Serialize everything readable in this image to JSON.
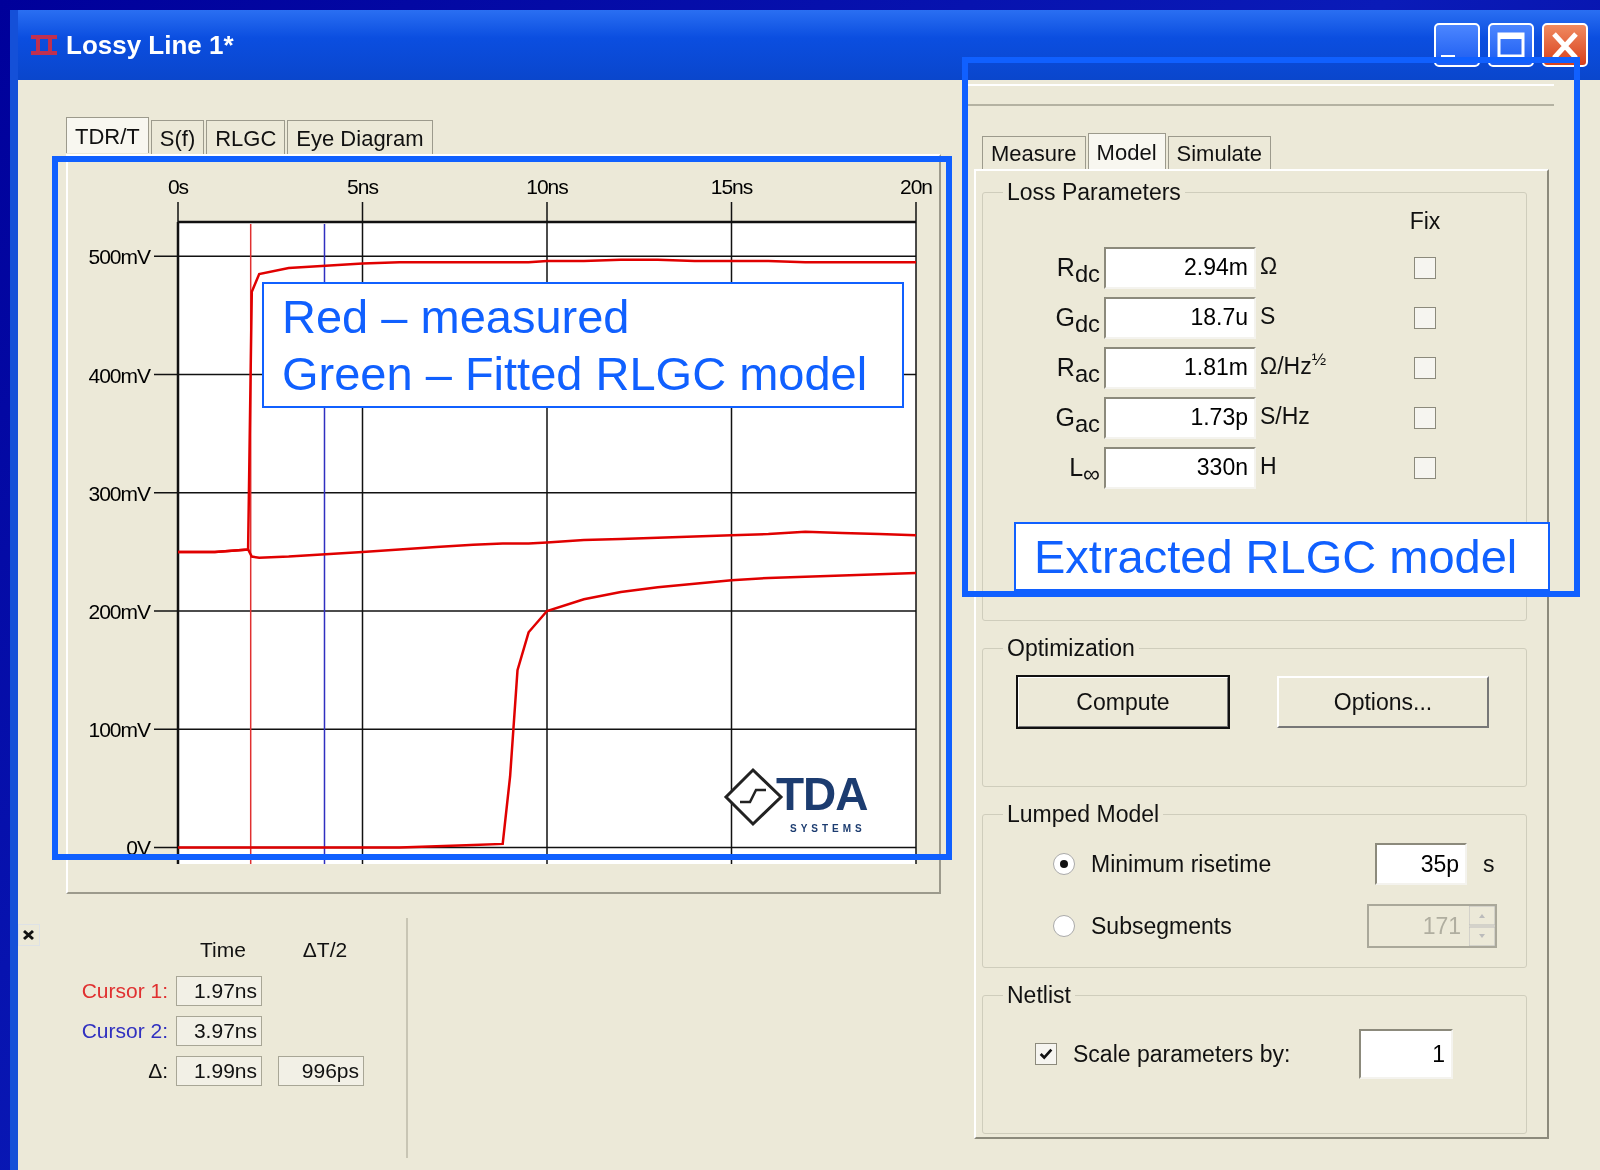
{
  "window": {
    "title": "Lossy Line 1*"
  },
  "left_tabs": [
    {
      "label": "TDR/T",
      "selected": true
    },
    {
      "label": "S(f)",
      "selected": false
    },
    {
      "label": "RLGC",
      "selected": false
    },
    {
      "label": "Eye Diagram",
      "selected": false
    }
  ],
  "chart": {
    "chart_data": {
      "type": "line",
      "x": [
        0,
        1,
        1.9,
        2,
        2.2,
        3,
        4,
        5,
        6,
        7,
        8,
        8.8,
        9,
        9.2,
        9.5,
        10,
        11,
        12,
        13,
        14,
        15,
        16,
        17,
        18,
        19,
        20
      ],
      "series": [
        {
          "color": "#e00000",
          "values": [
            250,
            250,
            252,
            470,
            485,
            490,
            492,
            494,
            495,
            495,
            495,
            495,
            495,
            495,
            495,
            496,
            496,
            497,
            497,
            496,
            496,
            496,
            495,
            495,
            495,
            495
          ]
        },
        {
          "color": "#e00000",
          "values": [
            250,
            250,
            252,
            246,
            245,
            246,
            248,
            250,
            252,
            254,
            256,
            257,
            257,
            257,
            257,
            258,
            260,
            261,
            262,
            263,
            264,
            265,
            267,
            266,
            265,
            264
          ]
        },
        {
          "color": "#e00000",
          "values": [
            0,
            0,
            0,
            0,
            0,
            0,
            0,
            0,
            0,
            1,
            2,
            3,
            60,
            150,
            182,
            200,
            210,
            216,
            220,
            223,
            226,
            228,
            229,
            230,
            231,
            232
          ]
        }
      ],
      "xlim": [
        0,
        20
      ],
      "ylim": [
        -14,
        529
      ],
      "xticks": [
        {
          "value": 0,
          "label": "0s"
        },
        {
          "value": 5,
          "label": "5ns"
        },
        {
          "value": 10,
          "label": "10ns"
        },
        {
          "value": 15,
          "label": "15ns"
        },
        {
          "value": 20,
          "label": "20n"
        }
      ],
      "yticks": [
        {
          "value": 0,
          "label": "0V"
        },
        {
          "value": 100,
          "label": "100mV"
        },
        {
          "value": 200,
          "label": "200mV"
        },
        {
          "value": 300,
          "label": "300mV"
        },
        {
          "value": 400,
          "label": "400mV"
        },
        {
          "value": 500,
          "label": "500mV"
        }
      ],
      "grid": true,
      "ref_lines": [
        {
          "axis": "x",
          "value": 1.97
        },
        {
          "axis": "x",
          "value": 3.97
        }
      ]
    },
    "logo": {
      "text": "TDA",
      "subtext": "SYSTEMS"
    }
  },
  "cursor_panel": {
    "columns": [
      "Time",
      "ΔT/2"
    ],
    "rows": [
      {
        "label": "Cursor 1:",
        "color": "#e03030",
        "values": [
          "1.97ns"
        ]
      },
      {
        "label": "Cursor 2:",
        "color": "#3030c0",
        "values": [
          "3.97ns"
        ]
      },
      {
        "label": "Δ:",
        "values": [
          "1.99ns",
          "996ps"
        ]
      }
    ]
  },
  "right_tabs": [
    {
      "label": "Measure",
      "selected": false
    },
    {
      "label": "Model",
      "selected": true
    },
    {
      "label": "Simulate",
      "selected": false
    }
  ],
  "loss_parameters": {
    "title": "Loss Parameters",
    "fix_label": "Fix",
    "rows": [
      {
        "label": "R$_{dc}$",
        "value": "2.94m",
        "unit": "Ω",
        "checked": false
      },
      {
        "label": "G$_{dc}$",
        "value": "18.7u",
        "unit": "S",
        "checked": false
      },
      {
        "label": "R$_{ac}$",
        "value": "1.81m",
        "unit": "Ω/Hz$^{½}$",
        "checked": false
      },
      {
        "label": "G$_{ac}$",
        "value": "1.73p",
        "unit": "S/Hz",
        "checked": false
      },
      {
        "label": "L$_{∞}$",
        "value": "330n",
        "unit": "H",
        "checked": false
      }
    ]
  },
  "optimization": {
    "title": "Optimization",
    "buttons": [
      {
        "label": "Compute",
        "default": true
      },
      {
        "label": "Options...",
        "default": false
      }
    ]
  },
  "lumped_model": {
    "title": "Lumped Model",
    "options": [
      {
        "kind": "field",
        "label": "Minimum risetime",
        "selected": true,
        "value": "35p",
        "unit": "s",
        "disabled": false
      },
      {
        "kind": "spinner",
        "label": "Subsegments",
        "selected": false,
        "value": "171",
        "disabled": true
      }
    ]
  },
  "netlist": {
    "title": "Netlist",
    "checkbox": {
      "label": "Scale parameters by:",
      "checked": true
    },
    "value": "1"
  },
  "callouts": [
    {
      "lines": [
        "Red – measured",
        "Green – Fitted RLGC model"
      ]
    },
    {
      "lines": [
        "Extracted RLGC model"
      ]
    }
  ]
}
